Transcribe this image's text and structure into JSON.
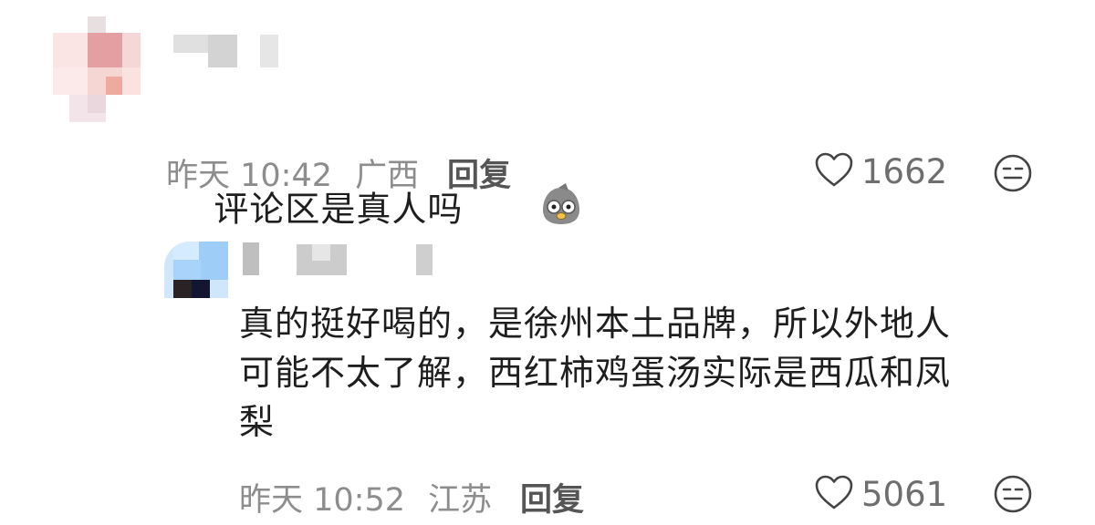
{
  "comments": [
    {
      "text": "评论区是真人吗",
      "emoji": "pigeon-surprised-emoji",
      "time": "昨天 10:42",
      "location": "广西",
      "reply_label": "回复",
      "likes": "1662"
    },
    {
      "text": "真的挺好喝的，是徐州本土品牌，所以外地人\n可能不太了解，西红柿鸡蛋汤实际是西瓜和凤\n梨",
      "time": "昨天 10:52",
      "location": "江苏",
      "reply_label": "回复",
      "likes": "5061"
    }
  ],
  "icons": {
    "like": "heart-outline-icon",
    "dislike": "meh-face-icon"
  },
  "colors": {
    "meta_text": "#8d8d8d",
    "body_text": "#1e1e1e"
  }
}
